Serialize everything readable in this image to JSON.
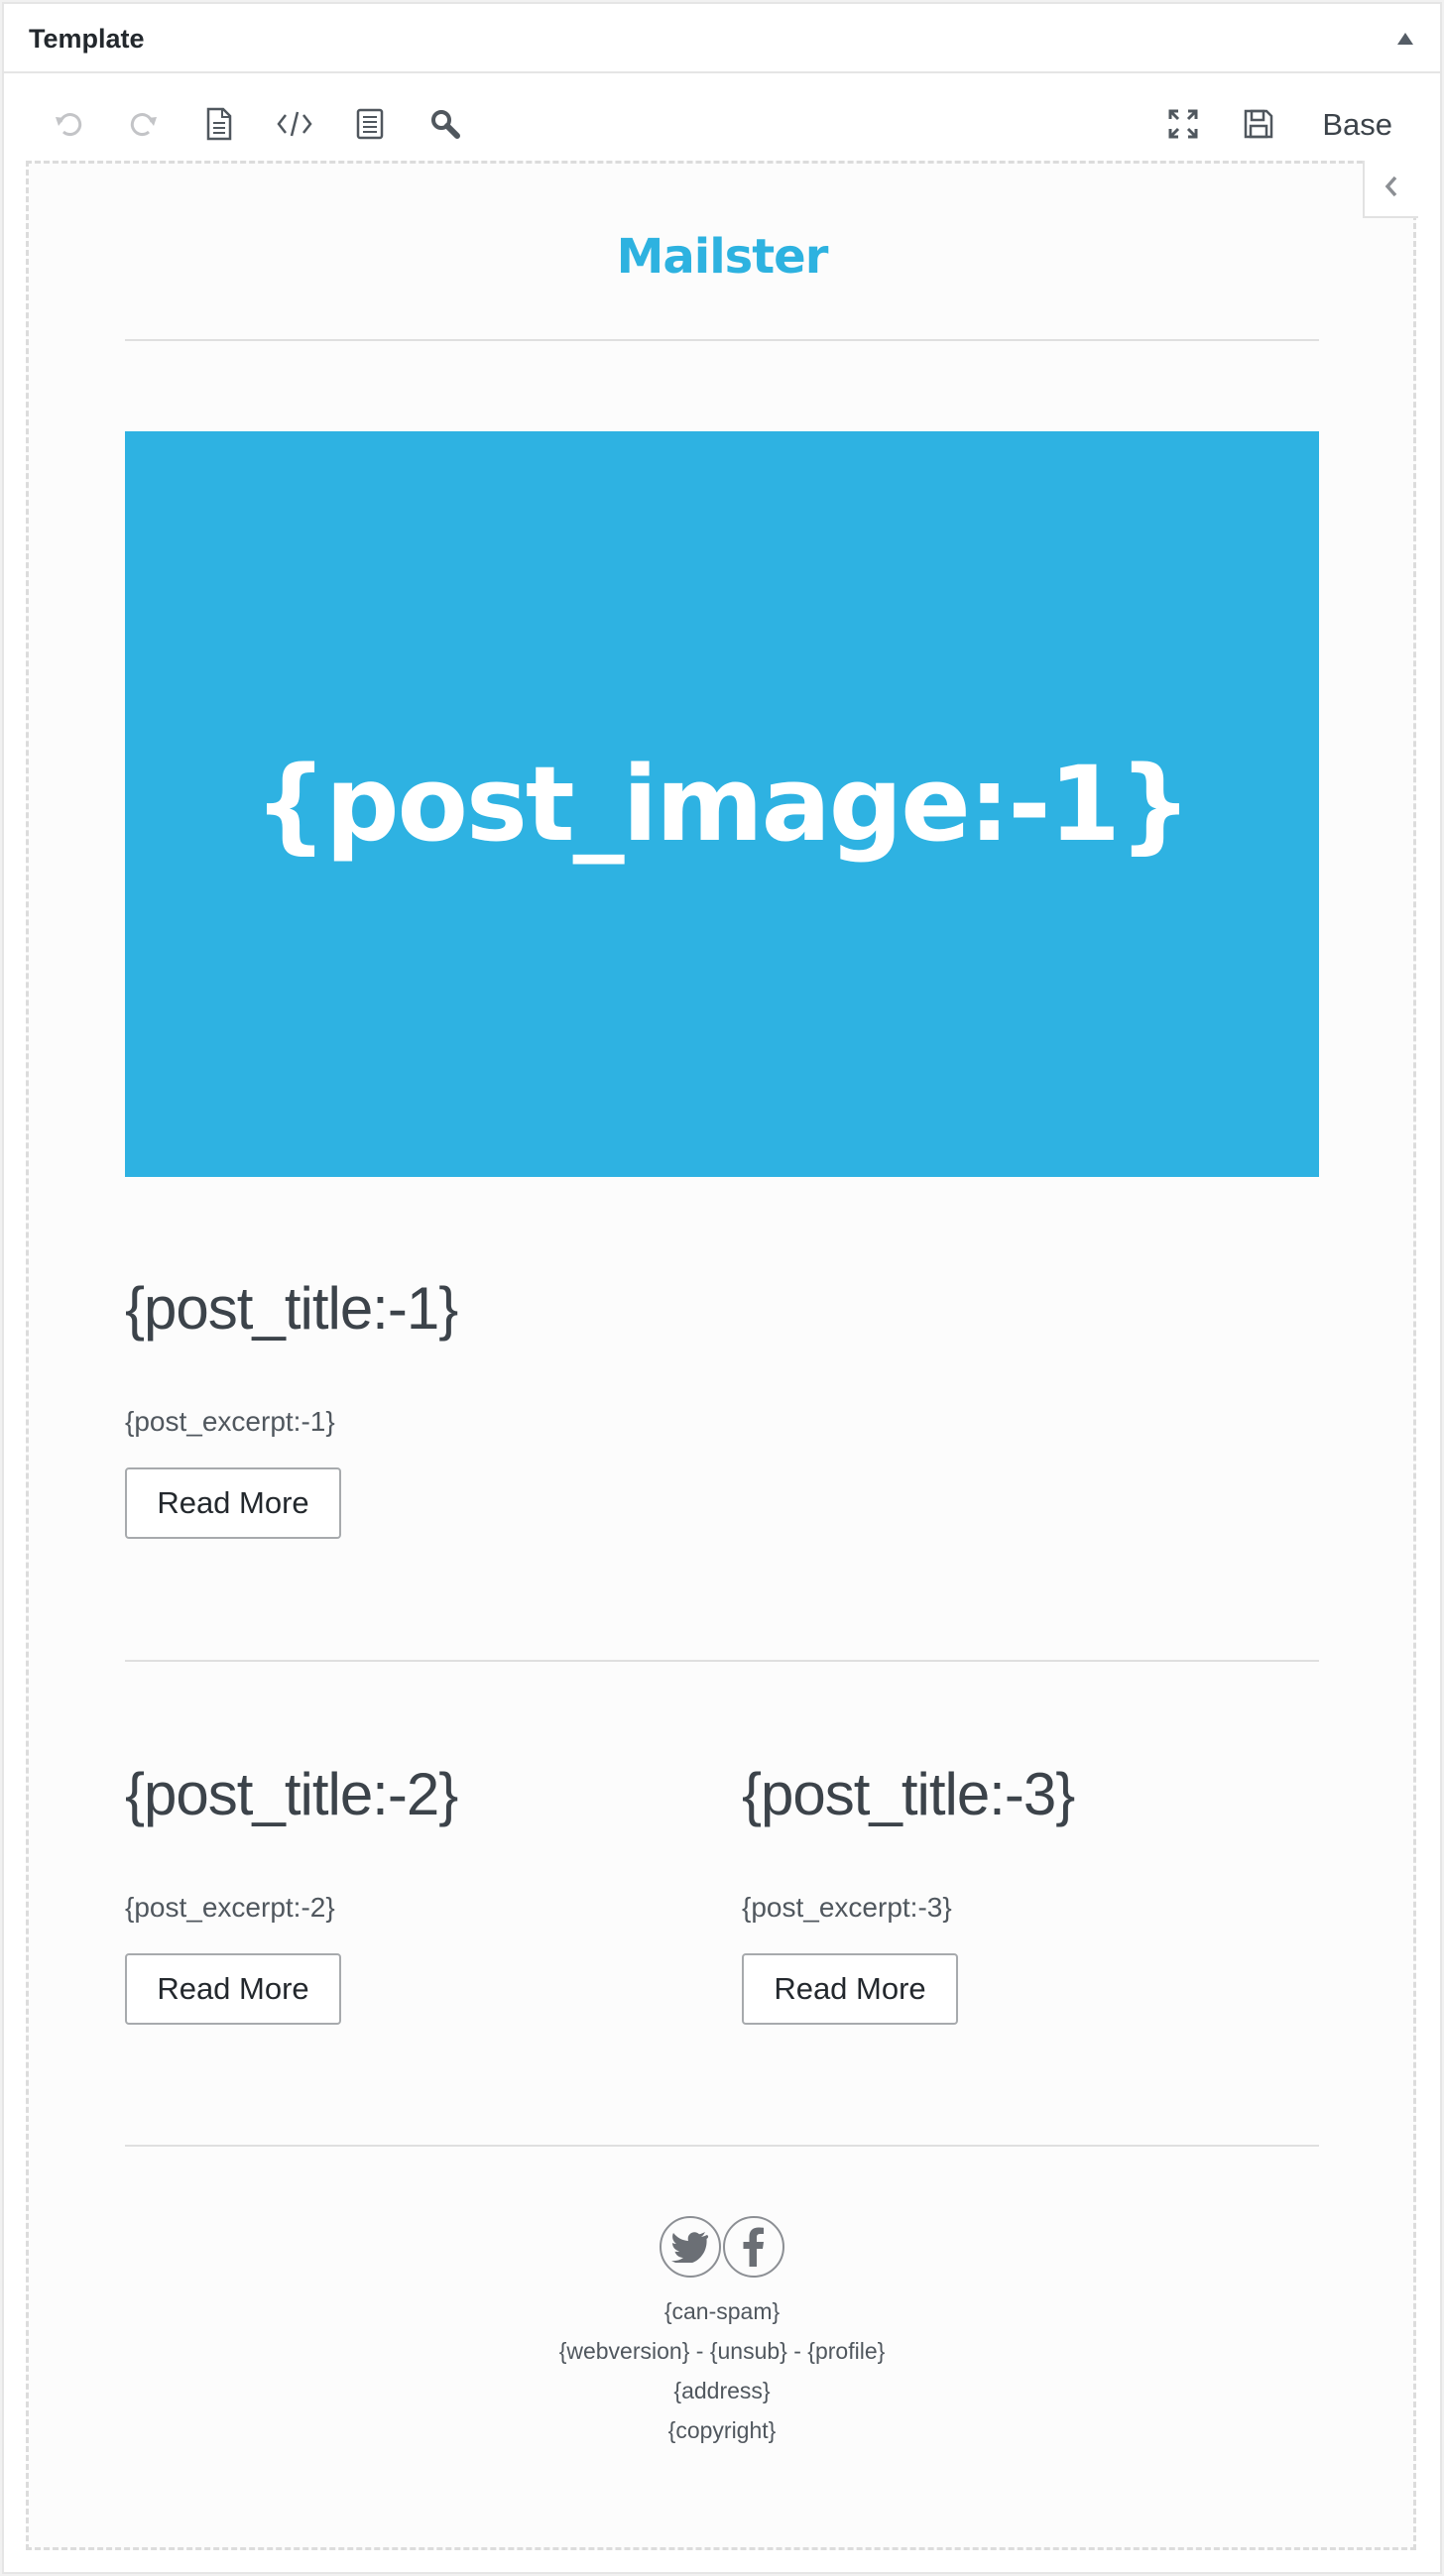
{
  "panel": {
    "title": "Template"
  },
  "toolbar": {
    "template_label": "Base",
    "icons": [
      "undo-icon",
      "redo-icon",
      "document-icon",
      "code-icon",
      "page-icon",
      "search-icon",
      "fullscreen-icon",
      "save-icon"
    ]
  },
  "email": {
    "logo": "Mailster",
    "hero_image": "{post_image:-1}",
    "post1": {
      "title": "{post_title:-1}",
      "excerpt": "{post_excerpt:-1}",
      "button": "Read More"
    },
    "post2": {
      "title": "{post_title:-2}",
      "excerpt": "{post_excerpt:-2}",
      "button": "Read More"
    },
    "post3": {
      "title": "{post_title:-3}",
      "excerpt": "{post_excerpt:-3}",
      "button": "Read More"
    },
    "footer": {
      "can_spam": "{can-spam}",
      "links": "{webversion} - {unsub} - {profile}",
      "address": "{address}",
      "copyright": "{copyright}"
    }
  },
  "colors": {
    "accent": "#2eb2e2",
    "text": "#3c434a",
    "border": "#a7aaad"
  }
}
